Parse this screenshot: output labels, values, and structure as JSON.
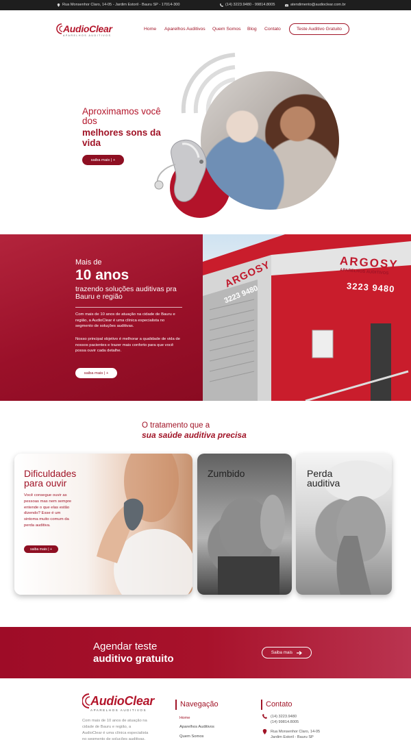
{
  "topbar": {
    "address": "Rua Monsenhor Claro, 14-05 - Jardim Estoril - Bauru SP - 17014-300",
    "phones": "(14) 3223.9480 - 99814.8005",
    "email": "atendimento@audioclear.com.br"
  },
  "brand": {
    "name": "AudioClear",
    "tagline": "Aparelhos Auditivos",
    "color": "#a01326"
  },
  "nav": {
    "items": [
      "Home",
      "Aparelhos Auditivos",
      "Quem Somos",
      "Blog",
      "Contato"
    ],
    "cta": "Teste Auditivo Gratuito"
  },
  "hero": {
    "line1": "Aproximamos você dos",
    "line2": "melhores sons da vida",
    "button": "saiba mais | +"
  },
  "about": {
    "prefix": "Mais de",
    "highlight": "10 anos",
    "subtitle": "trazendo soluções auditivas pra Bauru e região",
    "p1": "Com mais de 10 anos de atuação na cidade de Bauru e região, a AudioClear é uma clínica especialista no segmento de soluções auditivas.",
    "p2": "Nosso principal objetivo é melhorar a qualidade de vida de nossos pacientes e trazer mais conforto para que você possa ouvir cada detalhe.",
    "button": "saiba mais | +",
    "sign_line1": "ARGOSY",
    "sign_line2": "APARELHOS AUDITIVOS",
    "sign_phone": "3223 9480"
  },
  "treatment": {
    "line1": "O tratamento que a",
    "line2": "sua saúde auditiva precisa",
    "cards": [
      {
        "title": "Dificuldades para ouvir",
        "text": "Você consegue ouvir as pessoas mas nem sempre entende o que elas estão dizendo? Esse é um sintoma muito comum da perda auditiva.",
        "button": "saiba mais | +"
      },
      {
        "title": "Zumbido"
      },
      {
        "title": "Perda auditiva"
      }
    ]
  },
  "banner": {
    "line1": "Agendar teste",
    "line2": "auditivo gratuito",
    "button": "Saiba mais"
  },
  "footer": {
    "description": "Com mais de 10 anos de atuação na cidade de Bauru e região, a AudioClear é uma clínica especialista no segmento de soluções auditivas.",
    "nav_title": "Navegação",
    "links": [
      "Home",
      "Aparelhos Auditivos",
      "Quem Somos"
    ],
    "contact_title": "Contato",
    "contact_phones": [
      "(14) 3223.9480",
      "(14) 99814.8005"
    ],
    "contact_address": [
      "Rua Monsenhor Claro, 14-05",
      "Jardim Estoril - Bauru SP"
    ]
  }
}
